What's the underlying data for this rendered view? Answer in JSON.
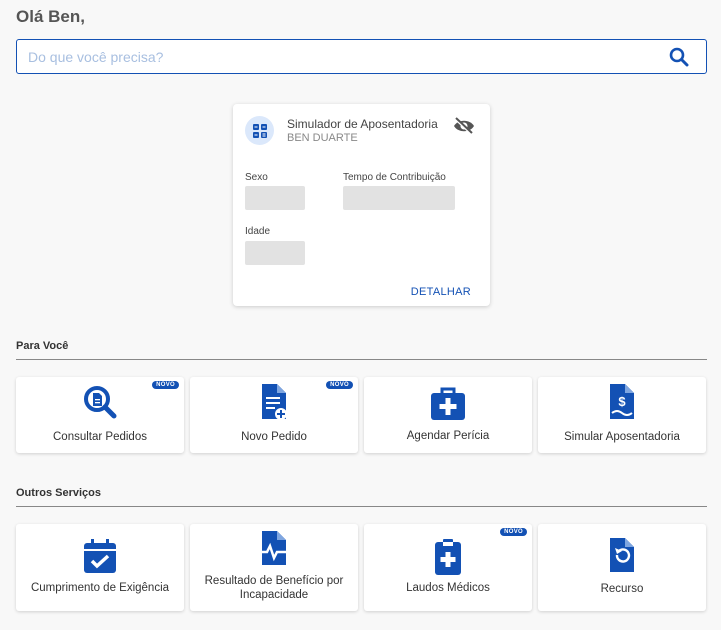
{
  "greeting": "Olá Ben,",
  "search": {
    "placeholder": "Do que você precisa?"
  },
  "simulator_card": {
    "title": "Simulador de Aposentadoria",
    "name": "BEN DUARTE",
    "fields": {
      "sexo": "Sexo",
      "tempo": "Tempo de Contribuição",
      "idade": "Idade"
    },
    "detail_link": "DETALHAR"
  },
  "sections": {
    "para_voce": {
      "title": "Para Você",
      "tiles": [
        {
          "label": "Consultar Pedidos",
          "icon": "search-document-icon",
          "badge": "NOVO"
        },
        {
          "label": "Novo Pedido",
          "icon": "new-document-icon",
          "badge": "NOVO"
        },
        {
          "label": "Agendar Perícia",
          "icon": "medical-kit-icon"
        },
        {
          "label": "Simular Aposentadoria",
          "icon": "money-document-icon"
        }
      ]
    },
    "outros": {
      "title": "Outros Serviços",
      "tiles": [
        {
          "label": "Cumprimento de Exigência",
          "icon": "calendar-check-icon"
        },
        {
          "label": "Resultado de Benefício por Incapacidade",
          "icon": "heartbeat-document-icon"
        },
        {
          "label": "Laudos Médicos",
          "icon": "medical-clipboard-icon",
          "badge": "NOVO"
        },
        {
          "label": "Recurso",
          "icon": "undo-document-icon"
        }
      ]
    }
  },
  "colors": {
    "accent": "#1351b4",
    "background": "#f8f8f8"
  }
}
